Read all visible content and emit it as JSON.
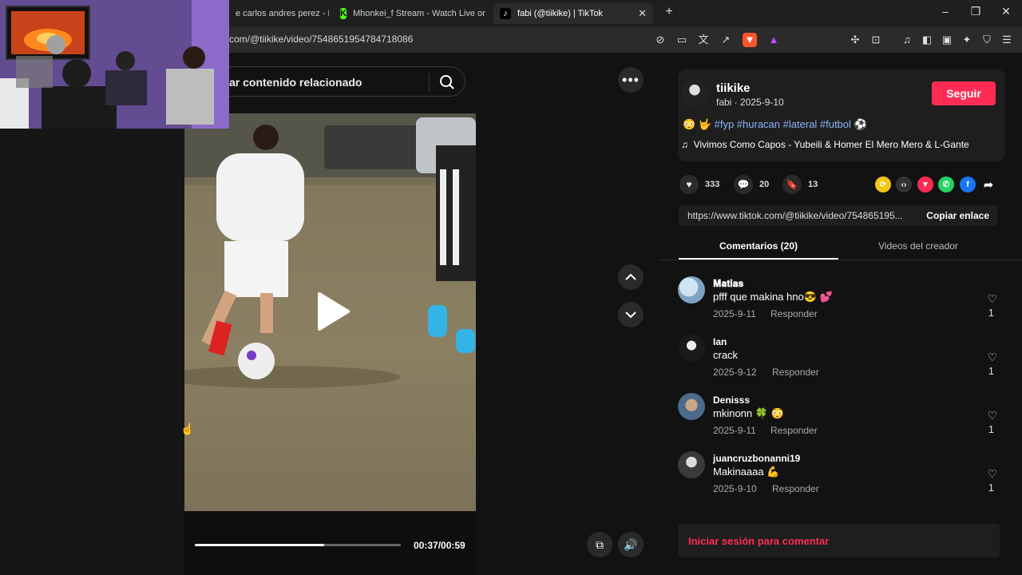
{
  "browser": {
    "tabs": [
      {
        "title": "e carlos andres perez - Bu"
      },
      {
        "title": "Mhonkei_f Stream - Watch Live on Ki"
      },
      {
        "title": "fabi (@tiikike) | TikTok"
      }
    ],
    "url": "com/@tiikike/video/7548651954784718086"
  },
  "search": {
    "text": "ar contenido relacionado"
  },
  "video": {
    "time": "00:37/00:59",
    "progress_fraction": 0.6271
  },
  "creator": {
    "username": "tiikike",
    "nick_date": "fabi · 2025-9-10",
    "follow_label": "Seguir",
    "caption_emoji": "😳 🤟",
    "caption_tags": "#fyp #huracan #lateral #futbol",
    "caption_ball": "⚽",
    "music": "Vivimos Como Capos - Yubeili & Homer El Mero Mero & L-Gante"
  },
  "stats": {
    "likes": "333",
    "comments": "20",
    "saves": "13"
  },
  "share_link": {
    "url": "https://www.tiktok.com/@tiikike/video/754865195...",
    "copy_label": "Copiar enlace"
  },
  "tabs": {
    "comments": "Comentarios (20)",
    "videos": "Videos del creador"
  },
  "comments": [
    {
      "user": "𝐌𝐚𝐭𝐢𝐚𝐬",
      "text": "pfff que makina hno😎 💕",
      "date": "2025-9-11",
      "reply": "Responder",
      "likes": "1"
    },
    {
      "user": "Ian",
      "text": "crack",
      "date": "2025-9-12",
      "reply": "Responder",
      "likes": "1"
    },
    {
      "user": "Denisss",
      "text": "mkinonn 🍀 😳",
      "date": "2025-9-11",
      "reply": "Responder",
      "likes": "1"
    },
    {
      "user": "juancruzbonanni19",
      "text": "Makinaaaa 💪",
      "date": "2025-9-10",
      "reply": "Responder",
      "likes": "1"
    }
  ],
  "login": {
    "text": "Iniciar sesión para comentar"
  },
  "colors": {
    "accent": "#fe2c55",
    "hashtag": "#8ab4f8"
  }
}
